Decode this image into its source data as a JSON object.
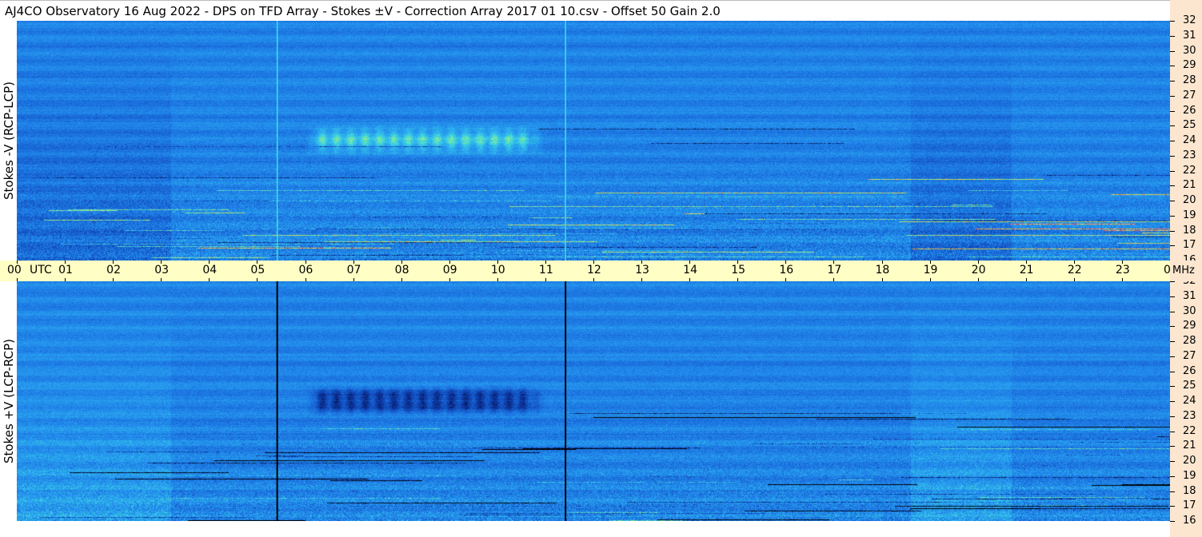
{
  "window": {
    "title": "AJ4CO Observatory  16 Aug 2022  -  DPS on TFD Array  -  Stokes ±V  -  Correction Array 2017 01 10.csv  -  Offset 50  Gain 2.0"
  },
  "chart_data": {
    "type": "heatmap",
    "title": "AJ4CO Observatory  16 Aug 2022  -  DPS on TFD Array  -  Stokes ±V  -  Correction Array 2017 01 10.csv  -  Offset 50  Gain 2.0",
    "time_axis": {
      "first_label": "00",
      "unit_label": "UTC",
      "ticks": [
        "01",
        "02",
        "03",
        "04",
        "05",
        "06",
        "07",
        "08",
        "09",
        "10",
        "11",
        "12",
        "13",
        "14",
        "15",
        "16",
        "17",
        "18",
        "19",
        "20",
        "21",
        "22",
        "23",
        "00"
      ],
      "range_hours": [
        0,
        24
      ]
    },
    "freq_axis": {
      "unit_label": "MHz",
      "ticks": [
        "32",
        "31",
        "30",
        "29",
        "28",
        "27",
        "26",
        "25",
        "24",
        "23",
        "22",
        "21",
        "20",
        "19",
        "18",
        "17",
        "16"
      ],
      "range_mhz": [
        16,
        32
      ]
    },
    "panels": [
      {
        "label": "Stokes -V (RCP-LCP)",
        "polarity": "negative",
        "marker_line_color": "#3ce0e8"
      },
      {
        "label": "Stokes +V (LCP-RCP)",
        "polarity": "positive",
        "marker_line_color": "#000000"
      }
    ],
    "marker_times_utc": [
      5.42,
      11.42
    ],
    "dark_event": {
      "start_utc": 6.0,
      "end_utc": 11.1,
      "freq_mhz": [
        23.0,
        25.1
      ]
    },
    "colormap": [
      "#000000",
      "#0a2a8c",
      "#1456c8",
      "#1f7fe8",
      "#2aa8f0",
      "#40d8e0",
      "#a8f070",
      "#ffe040",
      "#ff5a28",
      "#ff2ad0"
    ]
  }
}
